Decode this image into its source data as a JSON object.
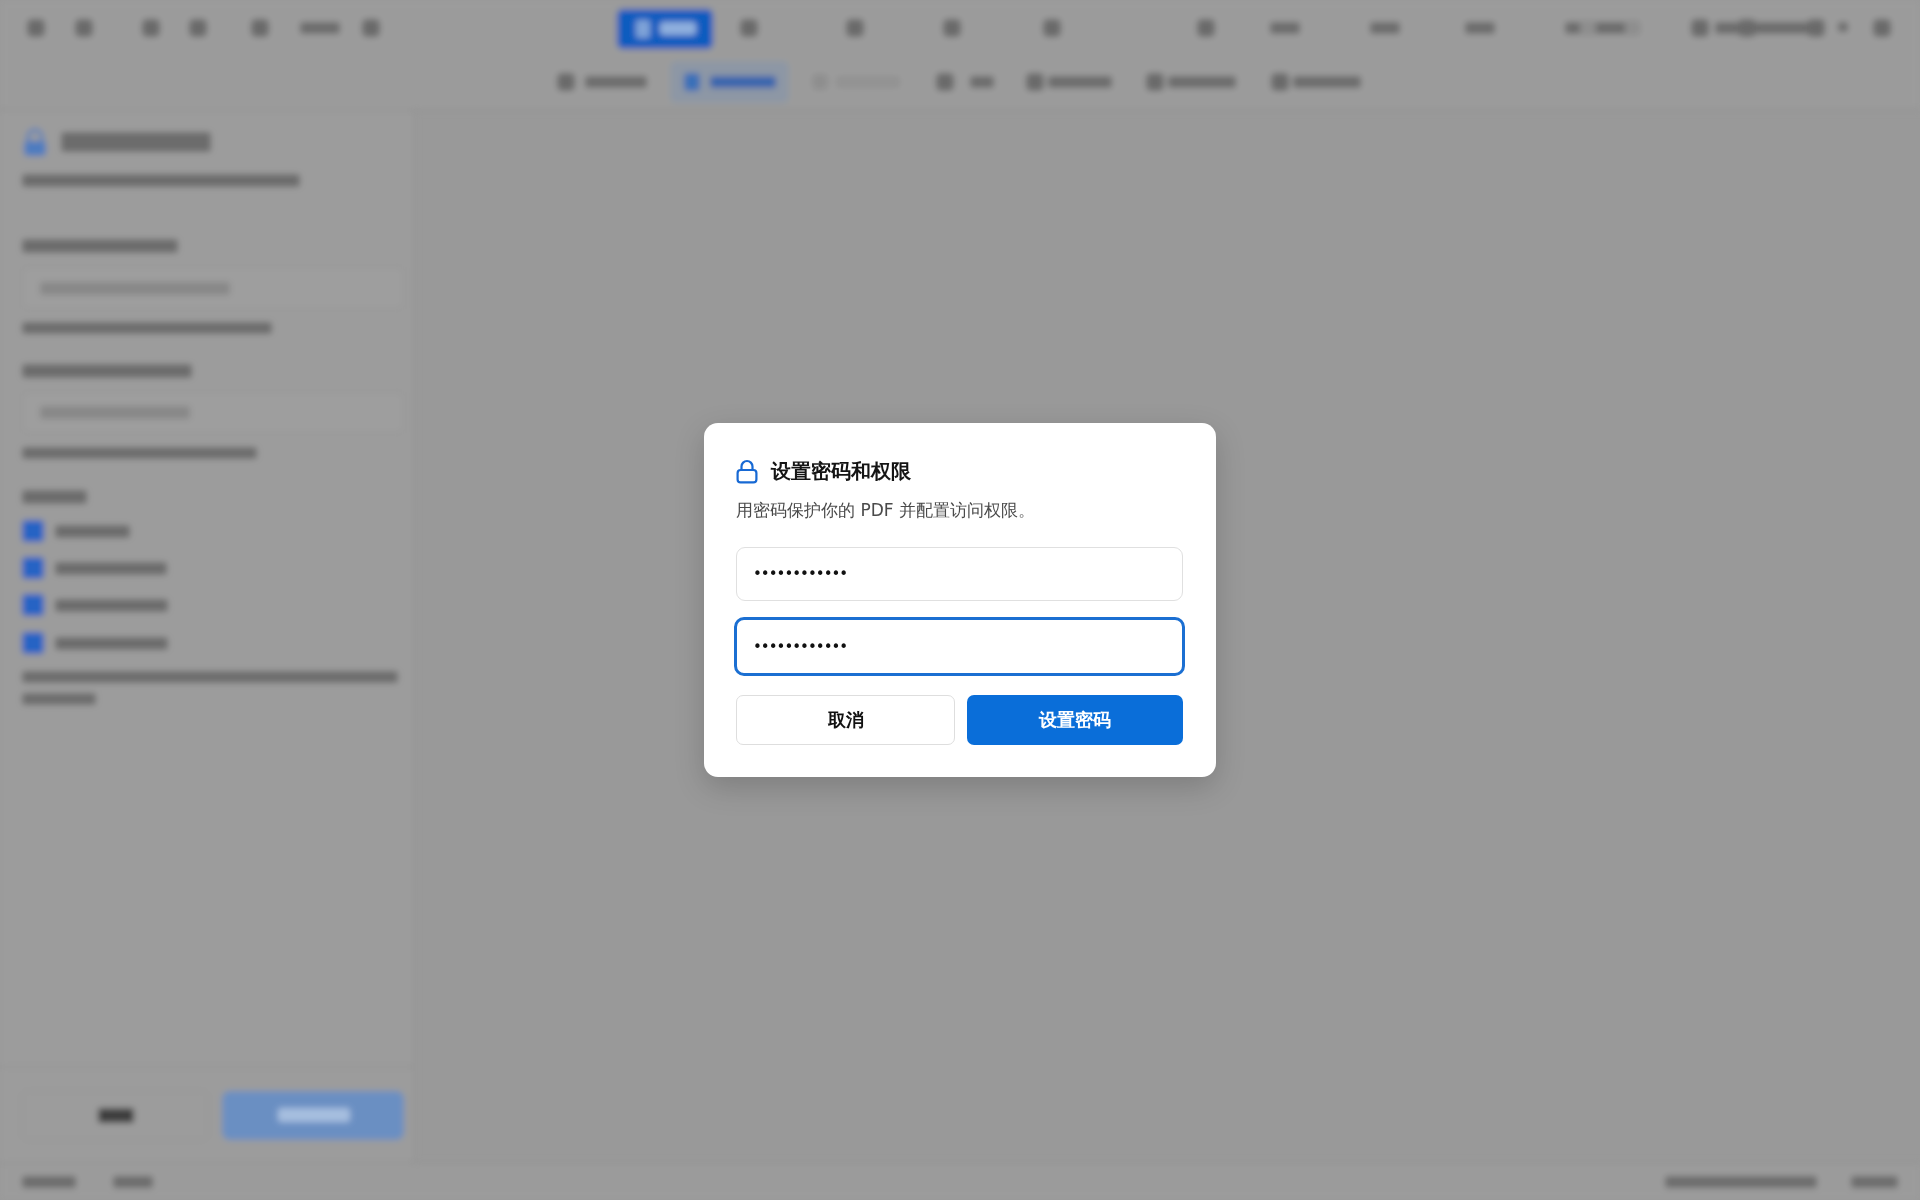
{
  "dialog": {
    "title": "设置密码和权限",
    "description": "用密码保护你的 PDF 并配置访问权限。",
    "fields": [
      {
        "value": "••••••••••••",
        "focused": false
      },
      {
        "value": "••••••••••••",
        "focused": true
      }
    ],
    "buttons": [
      {
        "label": "取消",
        "kind": "secondary"
      },
      {
        "label": "设置密码",
        "kind": "primary"
      }
    ]
  }
}
